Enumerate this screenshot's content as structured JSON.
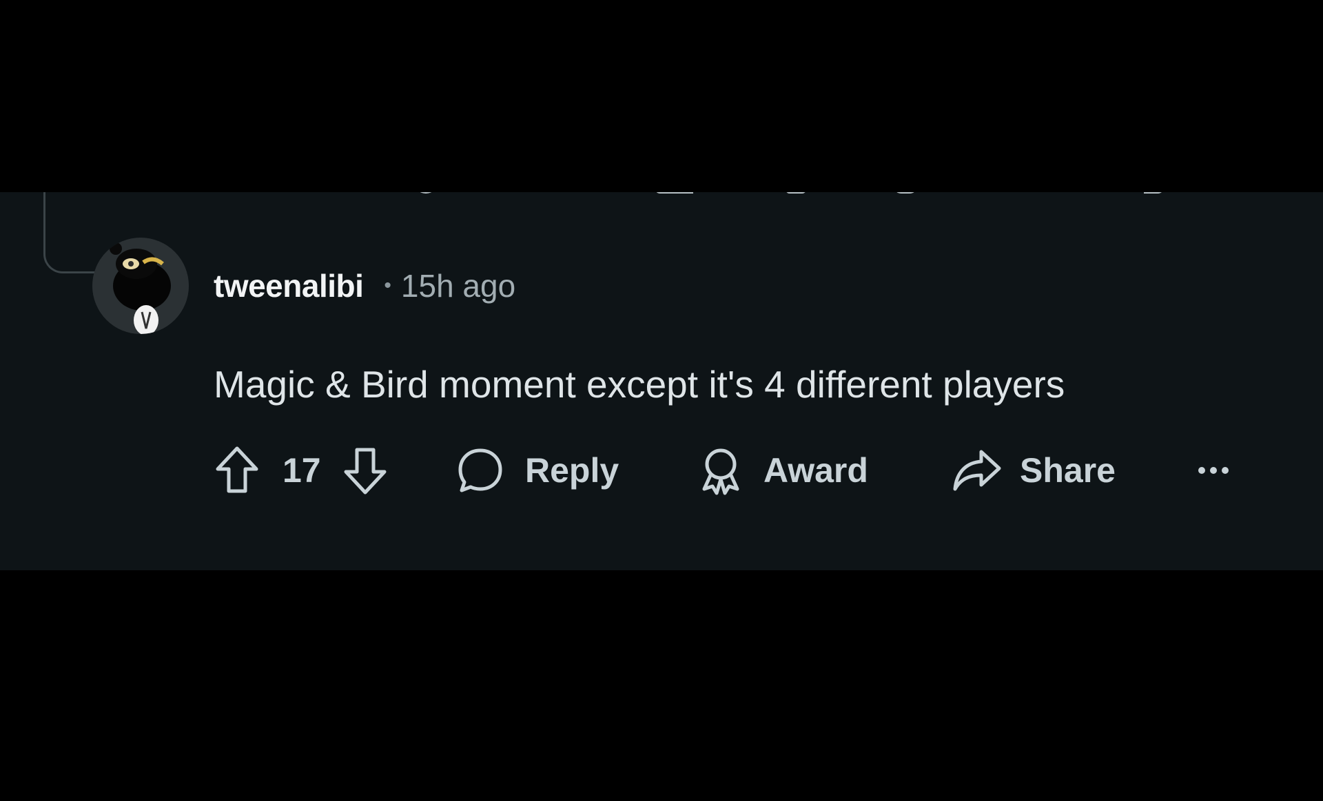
{
  "comment": {
    "author": "tweenalibi",
    "separator": "•",
    "timestamp": "15h ago",
    "body": "Magic & Bird moment except it's 4 different players",
    "avatar_icon": "snoo-avatar-icon"
  },
  "actions": {
    "upvote_icon": "arrow-up-icon",
    "vote_count": "17",
    "downvote_icon": "arrow-down-icon",
    "reply_label": "Reply",
    "reply_icon": "speech-bubble-icon",
    "award_label": "Award",
    "award_icon": "award-ribbon-icon",
    "share_label": "Share",
    "share_icon": "share-arrow-icon",
    "more_icon": "ellipsis-icon"
  },
  "colors": {
    "panel_background": "#0e1417",
    "outer_background": "#000000",
    "text_primary": "#f2f4f5",
    "text_secondary": "#a2adb2",
    "action_color": "#c9d3d8"
  }
}
